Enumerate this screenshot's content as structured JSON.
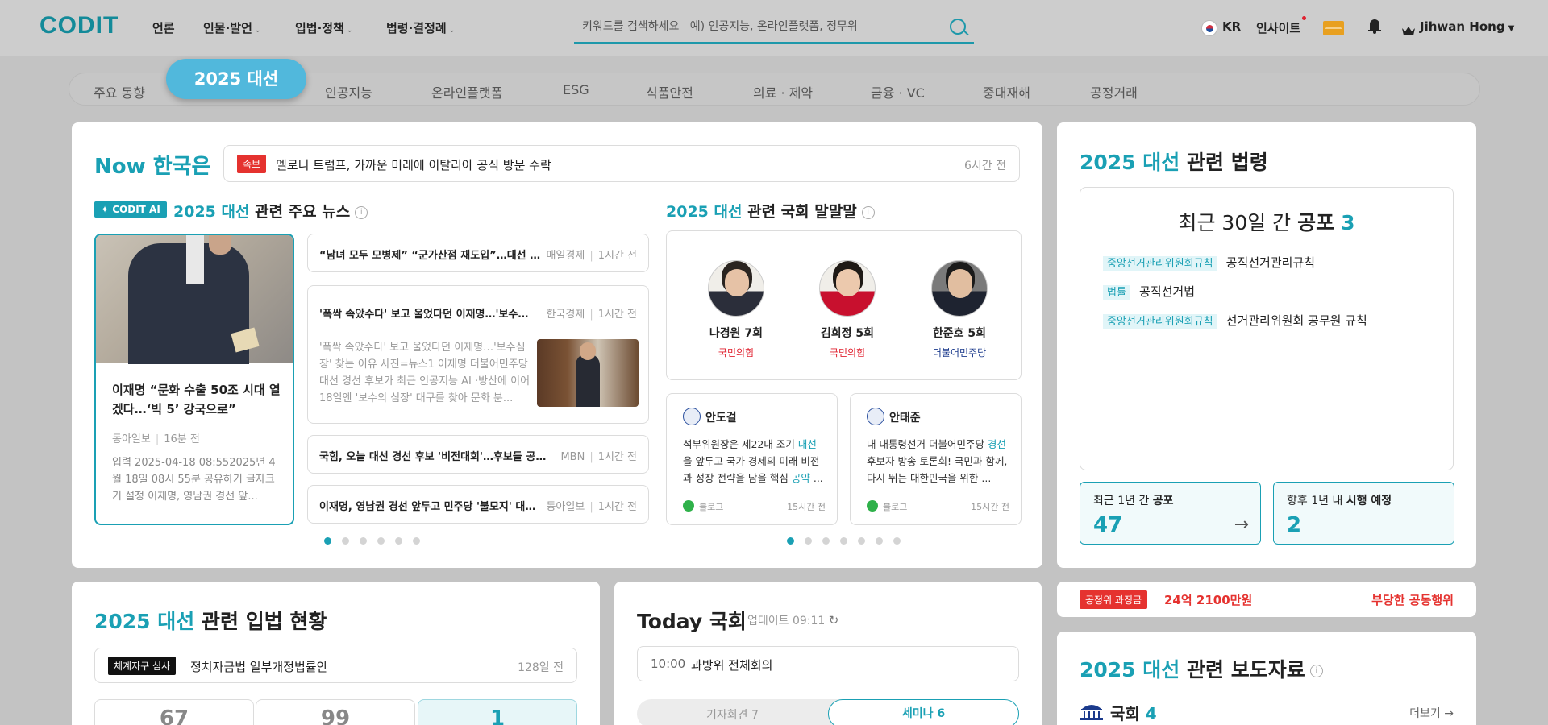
{
  "topbar": {
    "logo": "CODIT",
    "nav": [
      "언론",
      "인물·발언",
      "입법·정책",
      "법령·결정례"
    ],
    "search_placeholder": "키워드를 검색하세요   예) 인공지능, 온라인플랫폼, 정무위",
    "lang": "KR",
    "insight": "인사이트",
    "user": "Jihwan Hong"
  },
  "tabs": [
    "주요 동향",
    "2025 대선",
    "인공지능",
    "온라인플랫폼",
    "ESG",
    "식품안전",
    "의료 · 제약",
    "금융 · VC",
    "중대재해",
    "공정거래"
  ],
  "now": {
    "title_a": "Now",
    "title_b": "한국은",
    "breaking_tag": "속보",
    "breaking_text": "멜로니 트럼프, 가까운 미래에 이탈리아 공식 방문 수락",
    "breaking_time": "6시간 전"
  },
  "news": {
    "ai_badge": "CODIT AI",
    "heading_a": "2025 대선",
    "heading_b": "관련 주요 뉴스",
    "featured": {
      "title": "이재명 “문화 수출 50조 시대 열겠다…‘빅 5’ 강국으로”",
      "source": "동아일보",
      "time": "16분 전",
      "excerpt": "입력 2025-04-18 08:552025년 4월 18일 08시 55분 공유하기 글자크기 설정 이재명, 영남권 경선 앞..."
    },
    "items": [
      {
        "title": "“남녀 모두 모병제” “군가산점 재도입”…대선 경선 후보들 공약",
        "source": "매일경제",
        "time": "1시간 전"
      },
      {
        "title": "'폭싹 속았수다' 보고 울었다던 이재명…'보수심장' 대구로",
        "source": "한국경제",
        "time": "1시간 전",
        "excerpt": "'폭싹 속았수다' 보고 울었다던 이재명…'보수심장' 찾는 이유 사진=뉴스1 이재명 더불어민주당 대선 경선 후보가 최근 인공지능 AI ·방산에 이어 18일엔 '보수의 심장' 대구를 찾아 문화 분..."
      },
      {
        "title": "국힘, 오늘 대선 경선 후보 '비전대회'…후보들 공약 발표",
        "source": "MBN",
        "time": "1시간 전"
      },
      {
        "title": "이재명, 영남권 경선 앞두고 민주당 '불모지' 대구 찾아",
        "source": "동아일보",
        "time": "1시간 전"
      }
    ]
  },
  "speech": {
    "heading_a": "2025 대선",
    "heading_b": "관련 국회 말말말",
    "reps": [
      {
        "name": "나경원 7회",
        "party": "국민의힘",
        "color": "#e0212f"
      },
      {
        "name": "김희정 5회",
        "party": "국민의힘",
        "color": "#e0212f"
      },
      {
        "name": "한준호 5회",
        "party": "더불어민주당",
        "color": "#1b3a8c"
      }
    ],
    "quotes": [
      {
        "name": "안도걸",
        "pre": "석부위원장은 제22대 조기 ",
        "hl1": "대선",
        "mid": "을 앞두고 국가 경제의 미래 비전과 성장 전략을 담을 핵심 ",
        "hl2": "공약",
        "post": " ...",
        "source": "블로그",
        "time": "15시간 전"
      },
      {
        "name": "안태준",
        "pre": "대 대통령선거 더불어민주당 ",
        "hl1": "경선",
        "mid": " 후보자 방송 토론회!   국민과 함께, 다시 뛰는 대한민국을 위한 ...",
        "hl2": "",
        "post": "",
        "source": "블로그",
        "time": "15시간 전"
      }
    ]
  },
  "laws": {
    "heading_a": "2025 대선",
    "heading_b": "관련 법령",
    "summary_a": "최근 30일 간",
    "summary_b": "공포",
    "summary_count": "3",
    "items": [
      {
        "tag": "중앙선거관리위원회규칙",
        "name": "공직선거관리규칙"
      },
      {
        "tag": "법률",
        "name": "공직선거법"
      },
      {
        "tag": "중앙선거관리위원회규칙",
        "name": "선거관리위원회 공무원 규칙"
      }
    ],
    "stat1": {
      "label_a": "최근 1년 간",
      "label_b": "공포",
      "value": "47"
    },
    "stat2": {
      "label_a": "향후 1년 내",
      "label_b": "시행 예정",
      "value": "2"
    }
  },
  "legislation": {
    "heading_a": "2025 대선",
    "heading_b": "관련 입법 현황",
    "tag": "체계자구 심사",
    "bill": "정치자금법 일부개정법률안",
    "time": "128일 전",
    "counts": [
      "67",
      "99",
      "1"
    ]
  },
  "today": {
    "title": "Today 국회",
    "updated": "업데이트 09:11",
    "time": "10:00",
    "event": "과방위 전체회의",
    "tab1": "기자회견 7",
    "tab2": "세미나 6"
  },
  "fine": {
    "tag": "공정위 과징금",
    "amount": "24억 2100만원",
    "label": "부당한 공동행위"
  },
  "press": {
    "heading_a": "2025 대선",
    "heading_b": "관련 보도자료",
    "org": "국회",
    "count": "4",
    "more": "더보기 →"
  }
}
